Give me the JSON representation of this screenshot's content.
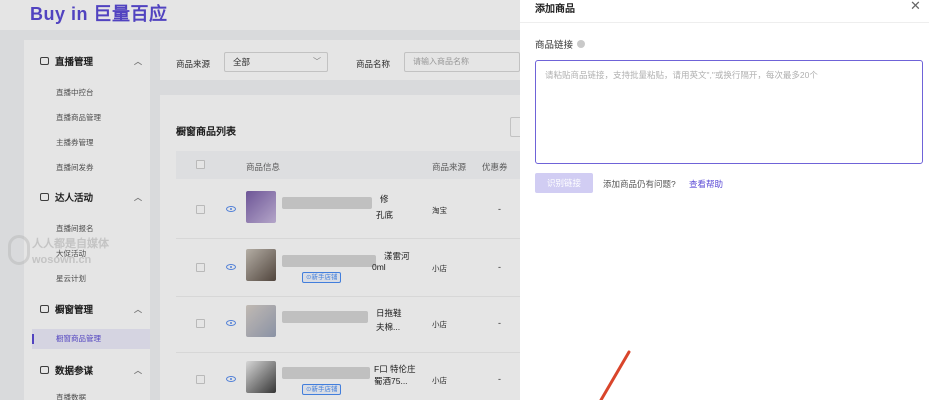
{
  "brand": {
    "logo_text": "Buy in 巨量百应",
    "accent": "#5b4bd6"
  },
  "sidebar": {
    "groups": [
      {
        "label": "直播管理",
        "icon": "live-icon",
        "items": [
          "直播中控台",
          "直播商品管理",
          "主播券管理",
          "直播间发券"
        ]
      },
      {
        "label": "达人活动",
        "icon": "activity-icon",
        "items": [
          "直播间报名",
          "大促活动",
          "星云计划"
        ]
      },
      {
        "label": "橱窗管理",
        "icon": "showcase-icon",
        "items": [
          "橱窗商品管理"
        ],
        "active_item": "橱窗商品管理"
      },
      {
        "label": "数据参谋",
        "icon": "data-icon",
        "items": [
          "直播数据"
        ]
      }
    ]
  },
  "filters": {
    "source_label": "商品来源",
    "source_value": "全部",
    "name_label": "商品名称",
    "name_placeholder": "请输入商品名称"
  },
  "list": {
    "title": "橱窗商品列表",
    "columns": [
      "商品信息",
      "商品来源",
      "优惠券"
    ],
    "rows": [
      {
        "frag1": "修",
        "frag2": "孔底",
        "source": "淘宝",
        "coupon": "-",
        "tag": ""
      },
      {
        "frag1": "漾雷河",
        "frag2": "0ml",
        "source": "小店",
        "coupon": "-",
        "tag": "新手店铺"
      },
      {
        "frag1": "日拖鞋",
        "frag2": "夫棉...",
        "source": "小店",
        "coupon": "-",
        "tag": ""
      },
      {
        "frag1": "F口 特伦庄",
        "frag2": "蜀酒75...",
        "source": "小店",
        "coupon": "-",
        "tag": "新手店铺"
      }
    ]
  },
  "watermark": {
    "line1": "人人都是自媒体",
    "line2": "wosown.cn"
  },
  "drawer": {
    "title": "添加商品",
    "field_label": "商品链接",
    "textarea_placeholder": "请粘贴商品链接，支持批量粘贴，请用英文\",\"或换行隔开，每次最多20个",
    "identify_button": "识别链接",
    "question": "添加商品仍有问题?",
    "help_link": "查看帮助"
  }
}
